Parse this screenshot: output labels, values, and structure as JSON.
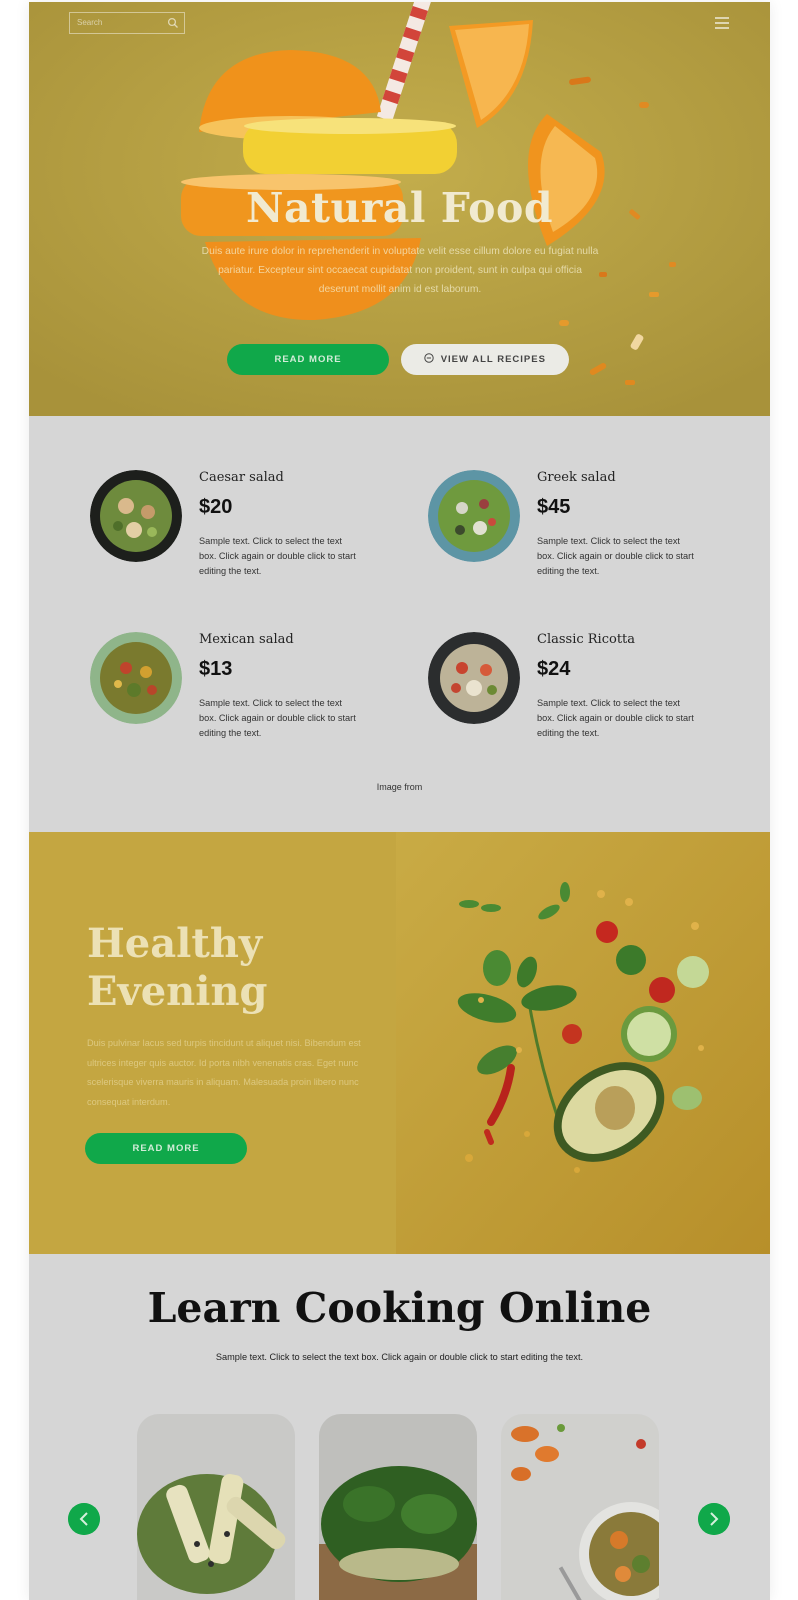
{
  "header": {
    "search_placeholder": "Search",
    "search_icon": "search-icon",
    "menu_icon": "hamburger-menu-icon"
  },
  "hero": {
    "title": "Natural Food",
    "text": "Duis aute irure dolor in reprehenderit in voluptate velit esse cillum dolore eu fugiat nulla pariatur. Excepteur sint occaecat cupidatat non proident, sunt in culpa qui officia deserunt mollit anim id est laborum.",
    "read_more_label": "READ MORE",
    "view_all_label": "VIEW ALL RECIPES"
  },
  "menu": {
    "items": [
      {
        "name": "Caesar salad",
        "price": "$20",
        "desc": "Sample text. Click to select the text box. Click again or double click to start editing the text."
      },
      {
        "name": "Greek salad",
        "price": "$45",
        "desc": "Sample text. Click to select the text box. Click again or double click to start editing the text."
      },
      {
        "name": "Mexican salad",
        "price": "$13",
        "desc": "Sample text. Click to select the text box. Click again or double click to start editing the text."
      },
      {
        "name": "Classic Ricotta",
        "price": "$24",
        "desc": "Sample text. Click to select the text box. Click again or double click to start editing the text."
      }
    ],
    "image_credit": "Image from"
  },
  "evening": {
    "title_line1": "Healthy",
    "title_line2": "Evening",
    "text": "Duis pulvinar lacus sed turpis tincidunt ut aliquet nisi. Bibendum est ultrices integer quis auctor. Id porta nibh venenatis cras. Eget nunc scelerisque viverra mauris in aliquam. Malesuada proin libero nunc consequat interdum.",
    "read_more_label": "READ MORE"
  },
  "learn": {
    "title": "Learn Cooking Online",
    "text": "Sample text. Click to select the text box. Click again or double click to start editing the text."
  },
  "colors": {
    "accent_green": "#10a84a",
    "hero_yellow": "#b9a341",
    "section_gray": "#d6d6d6"
  }
}
